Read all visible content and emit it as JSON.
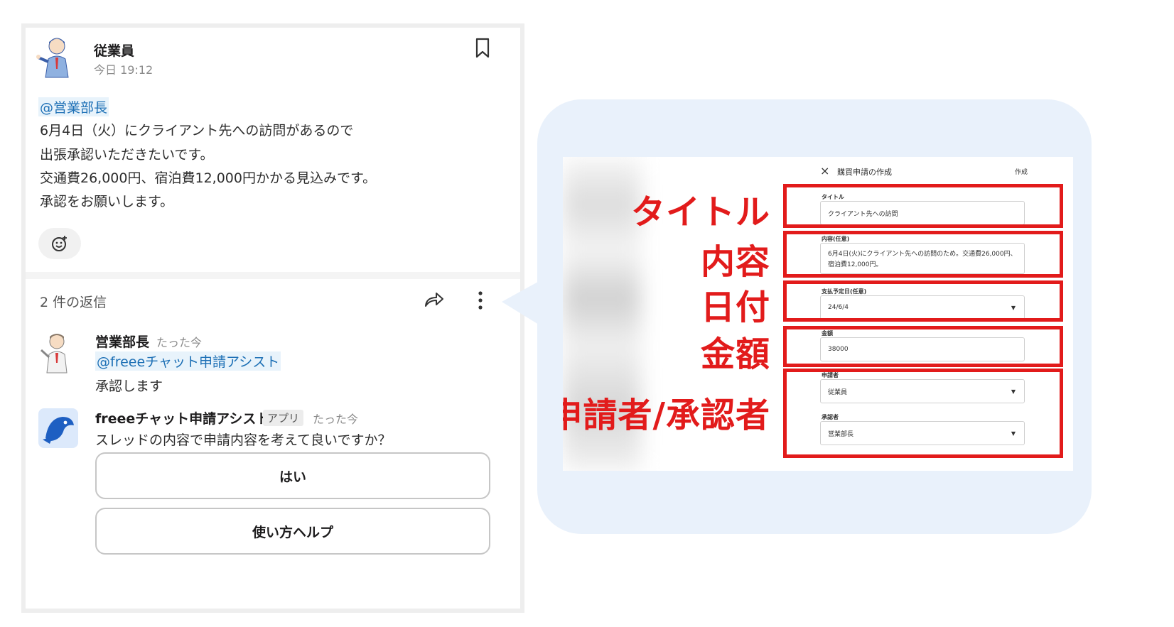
{
  "chat": {
    "post": {
      "author": "従業員",
      "time": "今日 19:12",
      "mention": "@営業部長",
      "lines": [
        "6月4日（火）にクライアント先への訪問があるので",
        "出張承認いただきたいです。",
        "交通費26,000円、宿泊費12,000円かかる見込みです。",
        "承認をお願いします。"
      ]
    },
    "thread": {
      "reply_count": "2 件の返信",
      "reply1": {
        "author": "営業部長",
        "time": "たった今",
        "mention": "@freeeチャット申請アシスト",
        "text": "承認します"
      },
      "reply2": {
        "author": "freeeチャット申請アシスト",
        "badge": "アプリ",
        "time": "たった今",
        "text": "スレッドの内容で申請内容を考えて良いですか？",
        "buttons": [
          "はい",
          "使い方ヘルプ"
        ]
      }
    }
  },
  "form": {
    "title": "購買申請の作成",
    "create_label": "作成",
    "close_icon": "×",
    "fields": {
      "title_label": "タイトル",
      "title_value": "クライアント先への訪問",
      "content_label": "内容(任意)",
      "content_value": "6月4日(火)にクライアント先への訪問のため。交通費26,000円、宿泊費12,000円。",
      "date_label": "支払予定日(任意)",
      "date_value": "24/6/4",
      "amount_label": "金額",
      "amount_value": "38000",
      "applicant_label": "申請者",
      "applicant_value": "従業員",
      "approver_label": "承認者",
      "approver_value": "営業部長"
    }
  },
  "annotations": [
    "タイトル",
    "内容",
    "日付",
    "金額",
    "申請者/承認者"
  ],
  "colors": {
    "highlight_red": "#e21b1b",
    "bubble_bg": "#e9f1fb",
    "mention_blue": "#1c6fb5"
  }
}
